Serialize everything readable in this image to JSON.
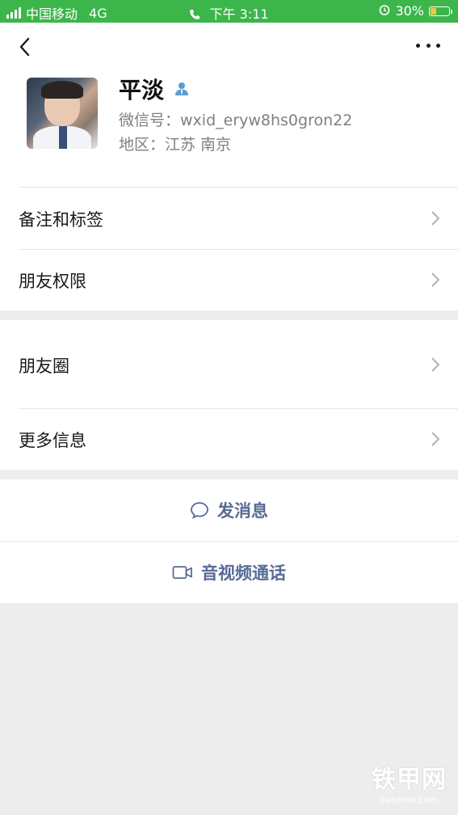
{
  "status_bar": {
    "carrier": "中国移动",
    "network": "4G",
    "time": "下午 3:11",
    "battery": "30%"
  },
  "profile": {
    "name": "平淡",
    "wechat_id": "微信号：wxid_eryw8hs0gron22",
    "region": "地区：江苏 南京"
  },
  "menu": {
    "remarks_tags": "备注和标签",
    "friend_permissions": "朋友权限",
    "moments": "朋友圈",
    "more_info": "更多信息"
  },
  "actions": {
    "send_message": "发消息",
    "video_call": "音视频通话"
  },
  "watermark": {
    "main": "铁甲网",
    "sub": "cehome.com"
  },
  "colors": {
    "status_bar": "#3cb64a",
    "link": "#576b95",
    "background": "#ededed"
  },
  "icons": [
    "back-arrow-icon",
    "more-dots-icon",
    "contact-person-icon",
    "chevron-right-icon",
    "chat-bubble-icon",
    "video-camera-icon",
    "phone-icon",
    "alarm-icon"
  ]
}
